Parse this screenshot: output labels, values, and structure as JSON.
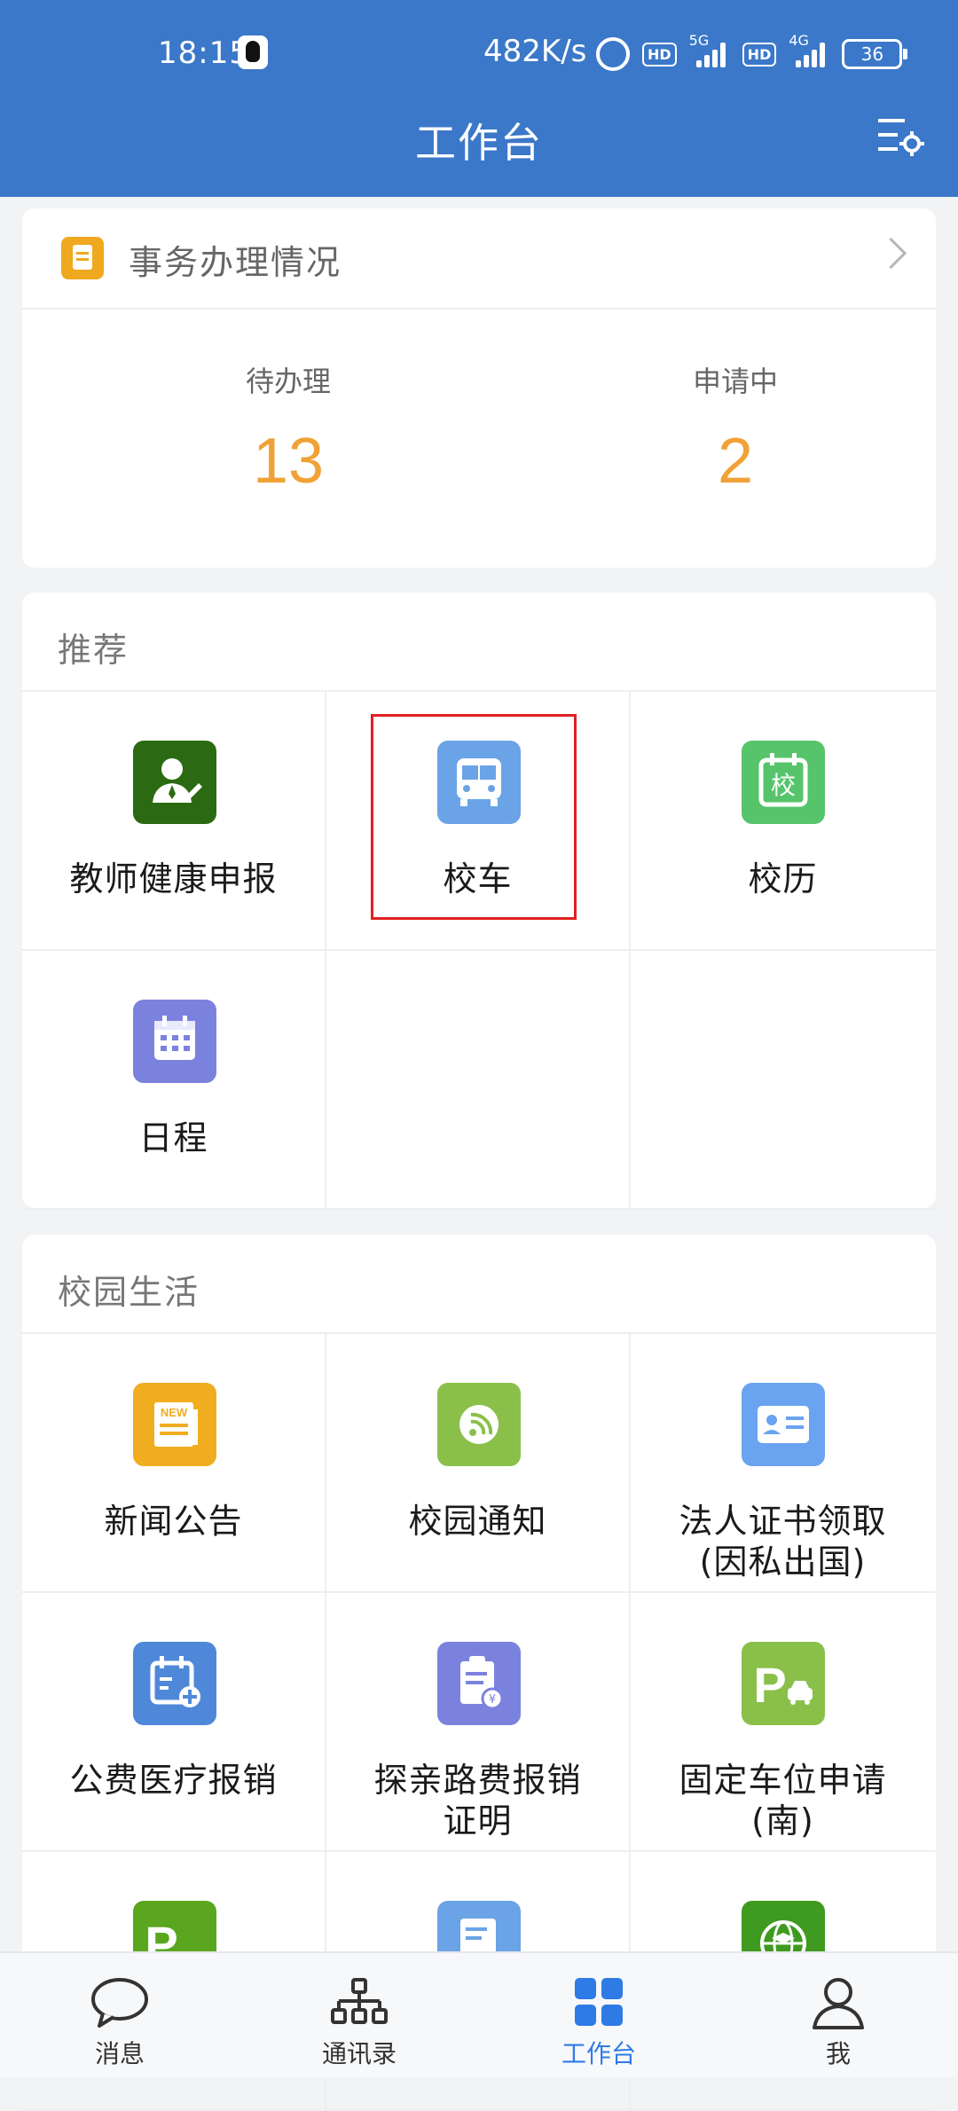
{
  "status_bar": {
    "time": "18:15",
    "speed": "482K/s",
    "network_1": "5G",
    "network_2": "4G",
    "hd": "HD",
    "battery": "36"
  },
  "header": {
    "title": "工作台"
  },
  "affairs": {
    "title": "事务办理情况",
    "pending_label": "待办理",
    "pending_value": "13",
    "applying_label": "申请中",
    "applying_value": "2"
  },
  "recommend": {
    "title": "推荐",
    "items": [
      {
        "label": "教师健康申报",
        "icon": "teacher-icon",
        "color": "#2b6a12"
      },
      {
        "label": "校车",
        "icon": "bus-icon",
        "color": "#6aa3e6"
      },
      {
        "label": "校历",
        "icon": "school-calendar-icon",
        "color": "#56c46b"
      },
      {
        "label": "日程",
        "icon": "calendar-icon",
        "color": "#7b82de"
      }
    ]
  },
  "campus_life": {
    "title": "校园生活",
    "items": [
      {
        "label": "新闻公告",
        "icon": "news-icon",
        "color": "#f0ad1f"
      },
      {
        "label": "校园通知",
        "icon": "broadcast-icon",
        "color": "#8ac04a"
      },
      {
        "label": "法人证书领取\n(因私出国)",
        "icon": "id-card-icon",
        "color": "#6aa3f0"
      },
      {
        "label": "公费医疗报销",
        "icon": "medical-calendar-icon",
        "color": "#4f88d9"
      },
      {
        "label": "探亲路费报销\n证明",
        "icon": "receipt-icon",
        "color": "#7b82de"
      },
      {
        "label": "固定车位申请\n(南)",
        "icon": "parking-icon",
        "color": "#8ac04a"
      },
      {
        "label": "",
        "icon": "parking-return-icon",
        "color": "#5aa61f"
      },
      {
        "label": "",
        "icon": "document-icon",
        "color": "#6aa3e6"
      },
      {
        "label": "",
        "icon": "globe-graduation-icon",
        "color": "#3f9a20"
      }
    ]
  },
  "bottom_nav": {
    "items": [
      {
        "label": "消息"
      },
      {
        "label": "通讯录"
      },
      {
        "label": "工作台"
      },
      {
        "label": "我"
      }
    ]
  }
}
